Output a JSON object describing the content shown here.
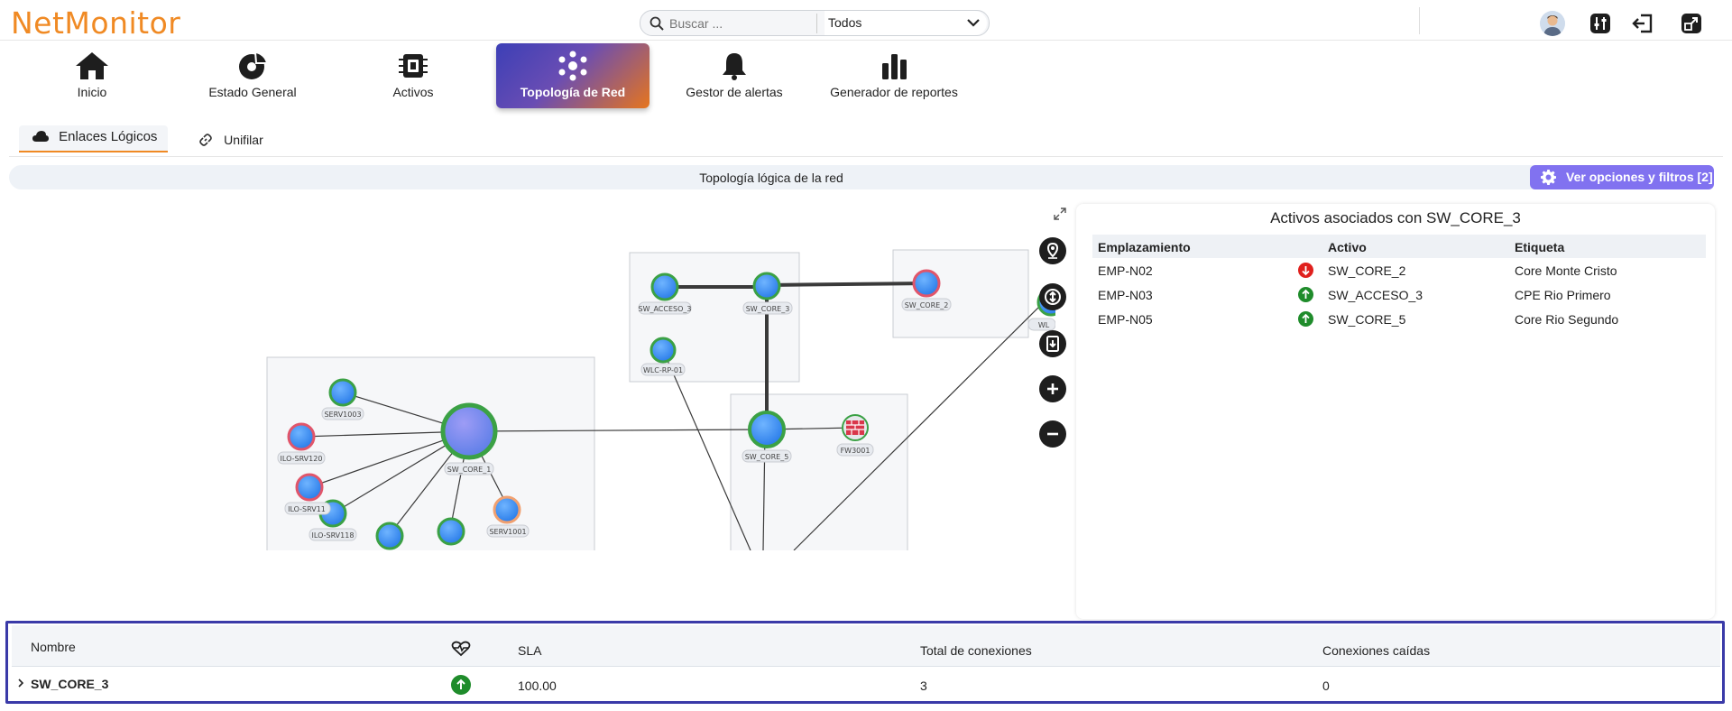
{
  "header": {
    "logo_text": "NetMonitor",
    "search_placeholder": "Buscar ...",
    "search_scope": "Todos"
  },
  "nav": {
    "items": [
      {
        "label": "Inicio",
        "icon": "home-icon"
      },
      {
        "label": "Estado General",
        "icon": "pie-chart-icon"
      },
      {
        "label": "Activos",
        "icon": "cpu-chip-icon"
      },
      {
        "label": "Topología de Red",
        "icon": "network-topology-icon",
        "active": true
      },
      {
        "label": "Gestor de alertas",
        "icon": "bell-icon"
      },
      {
        "label": "Generador de reportes",
        "icon": "bar-chart-icon"
      }
    ]
  },
  "subtabs": {
    "logical_links": "Enlaces Lógicos",
    "unify": "Unifilar"
  },
  "section": {
    "title": "Topología lógica de la red",
    "options_button": "Ver opciones y filtros [2]"
  },
  "topology": {
    "nodes": [
      {
        "label": "SW_ACCESO_3"
      },
      {
        "label": "SW_CORE_3"
      },
      {
        "label": "SW_CORE_2"
      },
      {
        "label": "WLC-RP-01"
      },
      {
        "label": "SW_CORE_1"
      },
      {
        "label": "SW_CORE_5"
      },
      {
        "label": "FW3001"
      },
      {
        "label": "SERV1003"
      },
      {
        "label": "ILO-SRV120"
      },
      {
        "label": "ILO-SRV11"
      },
      {
        "label": "ILO-SRV118"
      },
      {
        "label": "SERV1001"
      },
      {
        "label": "WL"
      }
    ]
  },
  "panel": {
    "title": "Activos asociados con SW_CORE_3",
    "columns": [
      "Emplazamiento",
      "Activo",
      "Etiqueta"
    ],
    "rows": [
      {
        "site": "EMP-N02",
        "status": "down",
        "asset": "SW_CORE_2",
        "tag": "Core Monte Cristo"
      },
      {
        "site": "EMP-N03",
        "status": "up",
        "asset": "SW_ACCESO_3",
        "tag": "CPE Rio Primero"
      },
      {
        "site": "EMP-N05",
        "status": "up",
        "asset": "SW_CORE_5",
        "tag": "Core Rio Segundo"
      }
    ]
  },
  "bottom_table": {
    "columns": {
      "name": "Nombre",
      "sla": "SLA",
      "total": "Total de conexiones",
      "down": "Conexiones caídas"
    },
    "rows": [
      {
        "name": "SW_CORE_3",
        "status": "up",
        "sla": "100.00",
        "total": "3",
        "down": "0"
      }
    ]
  },
  "colors": {
    "brand_orange": "#f08a24",
    "accent_purple": "#8172f0",
    "status_up": "#1f8c2b",
    "status_down": "#e0201d"
  }
}
